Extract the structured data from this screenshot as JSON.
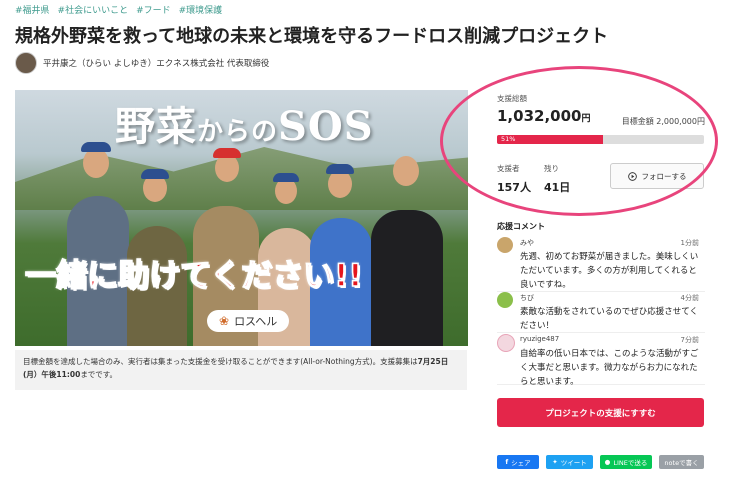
{
  "tags": [
    "#福井県",
    "#社会にいいこと",
    "#フード",
    "#環境保護"
  ],
  "title": "規格外野菜を救って地球の未来と環境を守るフードロス削減プロジェクト",
  "owner": "平井康之（ひらい よしゆき）エクネス株式会社 代表取締役",
  "hero": {
    "title_a": "野菜",
    "title_b": "からの",
    "title_c": "SOS",
    "banner": "一緒に助けてください!!",
    "logo_text": "ロスヘル"
  },
  "notice": {
    "text": "目標金額を達成した場合のみ、実行者は集まった支援金を受け取ることができます(All-or-Nothing方式)。支援募集は",
    "bold": "7月25日(月）午後11:00",
    "tail": "までです。"
  },
  "funding": {
    "total_label": "支援総額",
    "total": "1,032,000",
    "yen": "円",
    "goal": "目標金額 2,000,000円",
    "percent_label": "51%",
    "percent": 51,
    "backers_label": "支援者",
    "backers": "157人",
    "remaining_label": "残り",
    "remaining": "41日",
    "follow_label": "フォローする"
  },
  "comments_heading": "応援コメント",
  "comments": [
    {
      "user": "みや",
      "time": "1分前",
      "text": "先週、初めてお野菜が届きました。美味しくいただいています。多くの方が利用してくれると良いですね。"
    },
    {
      "user": "ちび",
      "time": "4分前",
      "text": "素敵な活動をされているのでぜひ応援させてください！"
    },
    {
      "user": "ryuzige487",
      "time": "7分前",
      "text": "自給率の低い日本では、このような活動がすごく大事だと思います。微力ながらお力になれたらと思います。"
    }
  ],
  "support_button": "プロジェクトの支援にすすむ",
  "share": {
    "facebook": "シェア",
    "twitter": "ツイート",
    "line": "LINEで送る",
    "note": "noteで書く"
  },
  "colors": {
    "accent": "#e4264a",
    "tag": "#3f9b8e",
    "highlight_ring": "#e8447c",
    "facebook": "#1877f2",
    "twitter": "#1da1f2",
    "line": "#06c755",
    "note": "#9aa0a6"
  }
}
